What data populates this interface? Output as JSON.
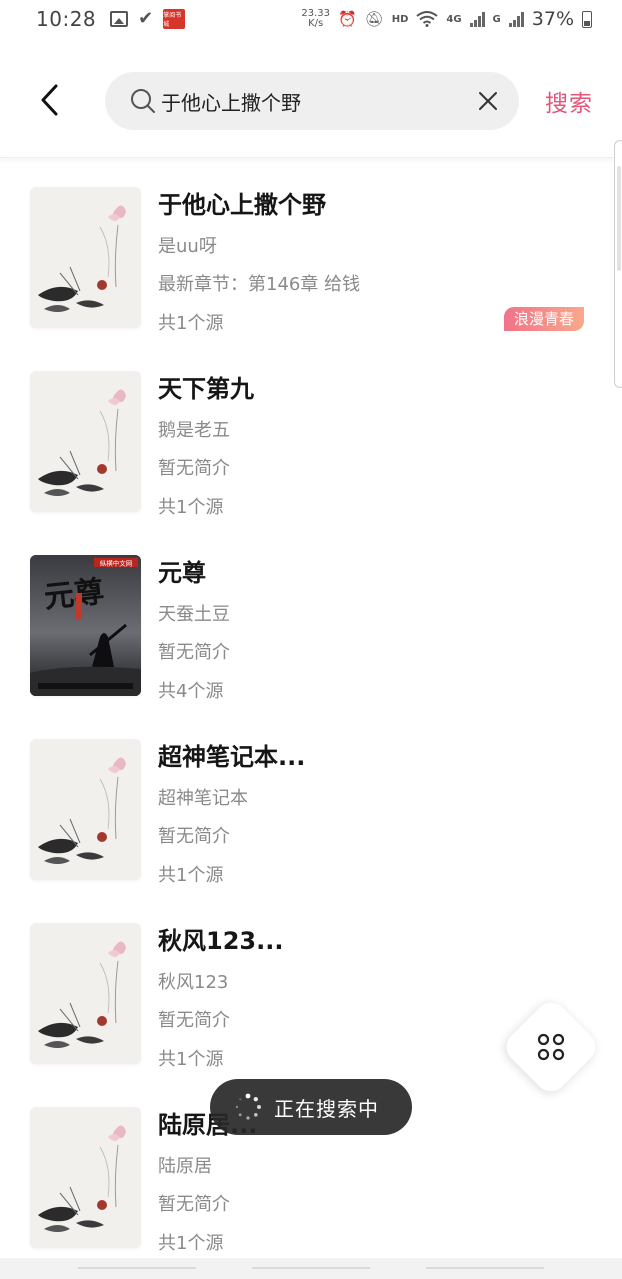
{
  "status_bar": {
    "time": "10:28",
    "app_icon_text": "掌阅书城",
    "net_speed_value": "23.33",
    "net_speed_unit": "K/s",
    "hd_label": "HD",
    "network_4g": "4G",
    "network_g": "G",
    "battery_percent": "37%"
  },
  "header": {
    "search_value": "于他心上撒个野",
    "search_button_label": "搜索"
  },
  "colors": {
    "accent": "#e2567a",
    "tag_gradient_start": "#f0738a",
    "tag_gradient_end": "#f7a98c"
  },
  "results": [
    {
      "title": "于他心上撒个野",
      "author": "是uu呀",
      "intro": "最新章节：第146章 给钱",
      "sources": "共1个源",
      "tag": "浪漫青春",
      "cover": "default-lotus-cover"
    },
    {
      "title": "天下第九",
      "author": "鹅是老五",
      "intro": "暂无简介",
      "sources": "共1个源",
      "cover": "default-lotus-cover"
    },
    {
      "title": "元尊",
      "author": "天蚕土豆",
      "intro": "暂无简介",
      "sources": "共4个源",
      "cover": "yuanzun-cover",
      "cover_title": "元尊",
      "cover_publisher": "纵横中文网"
    },
    {
      "title": "超神笔记本...",
      "author": "超神笔记本",
      "intro": "暂无简介",
      "sources": "共1个源",
      "cover": "default-lotus-cover"
    },
    {
      "title": "秋风123...",
      "author": "秋风123",
      "intro": "暂无简介",
      "sources": "共1个源",
      "cover": "default-lotus-cover"
    },
    {
      "title": "陆原居...",
      "author": "陆原居",
      "intro": "暂无简介",
      "sources": "共1个源",
      "cover": "default-lotus-cover"
    }
  ],
  "toast": {
    "text": "正在搜索中"
  },
  "fab": {
    "icon": "grid-menu-icon"
  }
}
